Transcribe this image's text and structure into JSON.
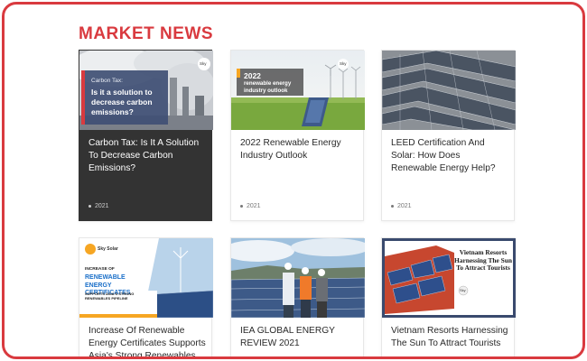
{
  "section": {
    "title": "MARKET NEWS"
  },
  "cards": [
    {
      "title": "Carbon Tax: Is It A Solution To Decrease Carbon Emissions?",
      "date": "2021",
      "thumb": {
        "small": "Carbon Tax:",
        "big": "Is it a solution to decrease carbon emissions?",
        "logo": "Sky",
        "colors": {
          "accent": "#d93a3f",
          "panel": "#3f4f74"
        }
      }
    },
    {
      "title": "2022 Renewable Energy Industry Outlook",
      "date": "2021",
      "thumb": {
        "big": "2022",
        "small": "renewable energy industry outlook",
        "logo": "Sky",
        "colors": {
          "accent": "#f6a623"
        }
      }
    },
    {
      "title": "LEED Certification And Solar: How Does Renewable Energy Help?",
      "date": "2021"
    },
    {
      "title": "Increase Of Renewable Energy Certificates Supports Asia's Strong Renewables",
      "date": "",
      "thumb": {
        "logo": "Sky Solar",
        "line1": "INCREASE OF",
        "line2": "RENEWABLE ENERGY CERTIFICATES",
        "line3": "SUPPORTS ASIA'S STRONG RENEWABLES PIPELINE",
        "colors": {
          "accent": "#1a6fc9",
          "orange": "#f6a623"
        }
      }
    },
    {
      "title": "IEA GLOBAL ENERGY REVIEW 2021",
      "date": ""
    },
    {
      "title": "Vietnam Resorts Harnessing The Sun To Attract Tourists",
      "date": "",
      "thumb": {
        "headline": "Vietnam Resorts Harnessing The Sun To Attract Tourists",
        "logo": "Sky",
        "colors": {
          "frame": "#3a4a6e",
          "roof": "#c7472f"
        }
      }
    }
  ]
}
